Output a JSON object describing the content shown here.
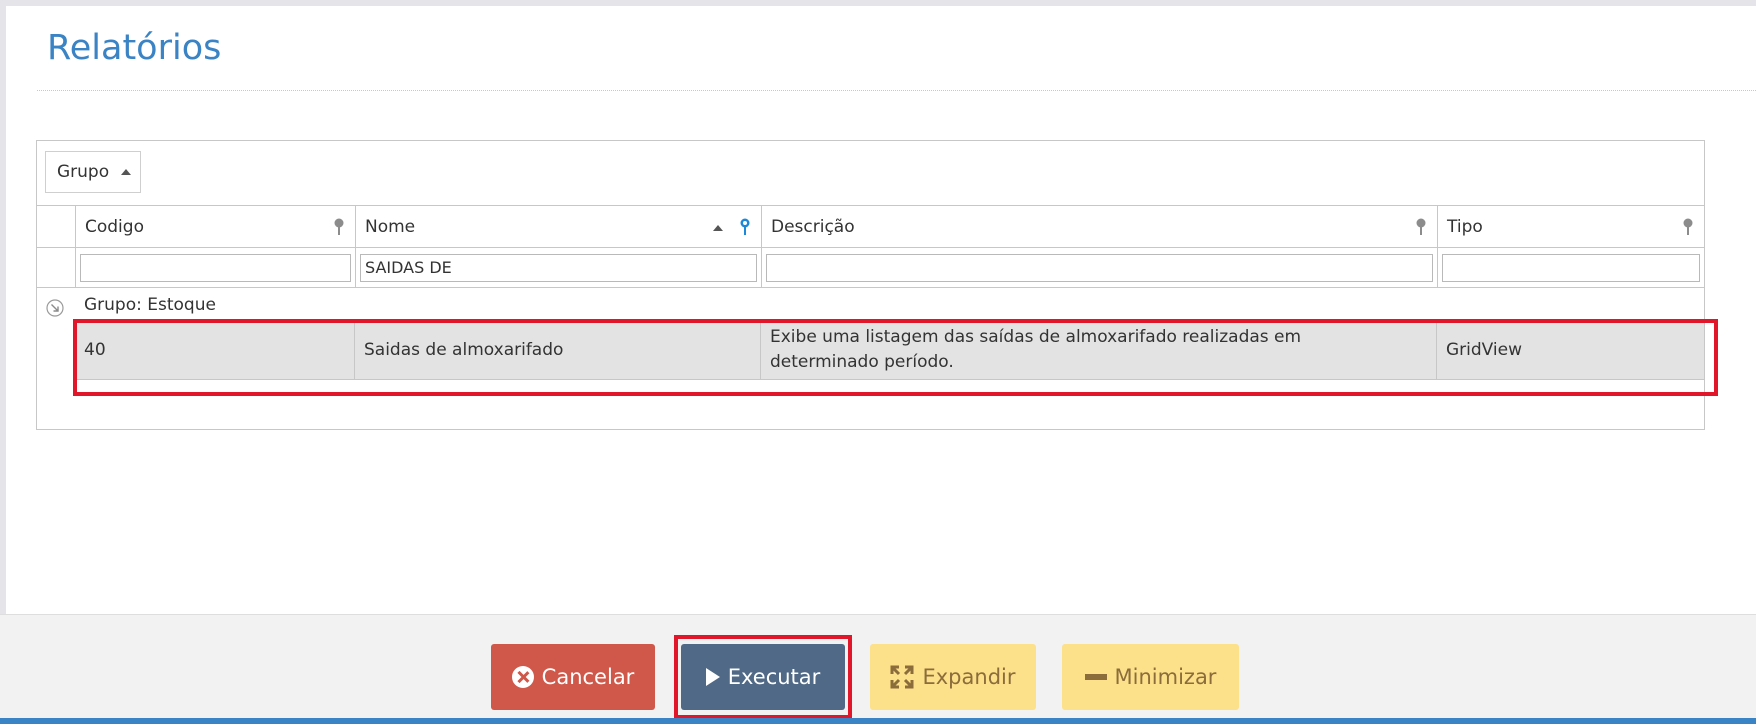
{
  "page": {
    "title": "Relatórios"
  },
  "grid": {
    "group_panel": {
      "chip_label": "Grupo"
    },
    "columns": [
      {
        "label": "Codigo"
      },
      {
        "label": "Nome"
      },
      {
        "label": "Descrição"
      },
      {
        "label": "Tipo"
      }
    ],
    "filters": {
      "codigo": "",
      "nome": "SAIDAS DE",
      "descricao": "",
      "tipo": ""
    },
    "group_row": {
      "label": "Grupo: Estoque"
    },
    "rows": [
      {
        "codigo": "40",
        "nome": "Saidas de almoxarifado",
        "descricao": "Exibe uma listagem das saídas de almoxarifado realizadas em determinado período.",
        "tipo": "GridView"
      }
    ]
  },
  "footer": {
    "cancel_label": "Cancelar",
    "execute_label": "Executar",
    "expand_label": "Expandir",
    "minimize_label": "Minimizar"
  },
  "colors": {
    "accent": "#3a83c4",
    "cancel": "#d0584a",
    "execute": "#4f6986",
    "warning": "#fde08a",
    "highlight": "#e2162a",
    "filter_active_pin": "#1e88d8"
  }
}
